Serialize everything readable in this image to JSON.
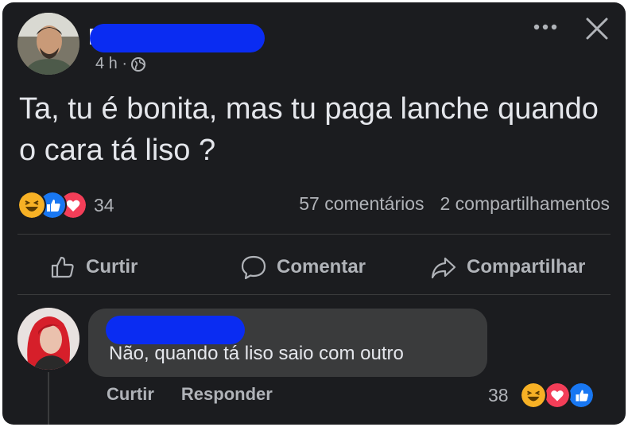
{
  "post": {
    "author_name": "",
    "time": "4 h ·",
    "text": "Ta, tu é bonita, mas tu paga lanche quando o cara tá liso ?",
    "reaction_count": "34",
    "comments_count": "57 comentários",
    "shares_count": "2 compartilhamentos",
    "reaction_icons": [
      "haha-icon",
      "like-icon",
      "love-icon"
    ]
  },
  "actions": {
    "like": "Curtir",
    "comment": "Comentar",
    "share": "Compartilhar"
  },
  "comment": {
    "author_name": "",
    "text": "Não, quando tá liso saio com outro",
    "like": "Curtir",
    "reply": "Responder",
    "reaction_count": "38",
    "reaction_icons": [
      "haha-icon",
      "love-icon",
      "like-icon"
    ]
  },
  "colors": {
    "background": "#1b1c1f",
    "bubble": "#3a3b3c",
    "text": "#e4e6eb",
    "secondary_text": "#b0b3b8",
    "redaction": "#0a2cf2",
    "like": "#1877f2",
    "love": "#f33e58",
    "haha": "#f7b125"
  }
}
